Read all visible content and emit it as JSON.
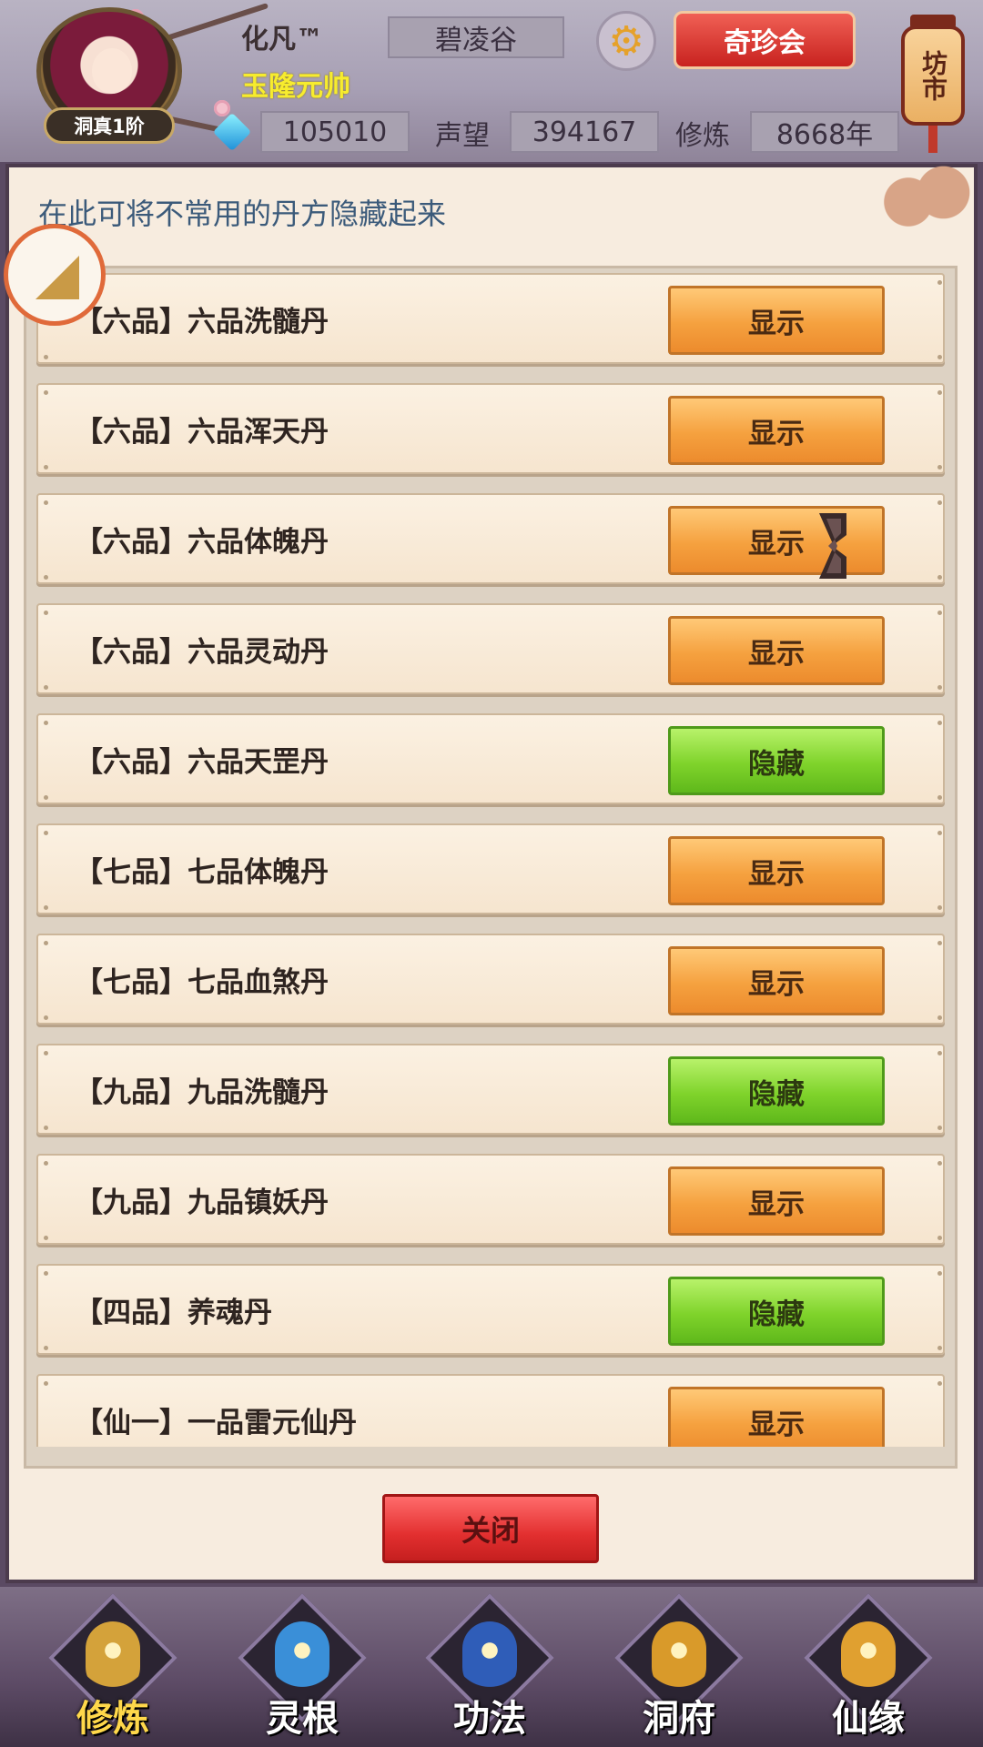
{
  "header": {
    "player_name": "化凡™",
    "player_title": "玉隆元帅",
    "rank_badge": "洞真1阶",
    "sect": "碧凌谷",
    "treasure_button": "奇珍会",
    "market_lantern": "坊市",
    "gems": "105010",
    "reputation_label": "声望",
    "reputation": "394167",
    "cultivation_label": "修炼",
    "cultivation": "8668年"
  },
  "panel": {
    "hint": "在此可将不常用的丹方隐藏起来",
    "close_label": "关闭",
    "rows": [
      {
        "text": "【六品】六品洗髓丹",
        "button": "显示",
        "state": "show"
      },
      {
        "text": "【六品】六品浑天丹",
        "button": "显示",
        "state": "show"
      },
      {
        "text": "【六品】六品体魄丹",
        "button": "显示",
        "state": "show"
      },
      {
        "text": "【六品】六品灵动丹",
        "button": "显示",
        "state": "show"
      },
      {
        "text": "【六品】六品天罡丹",
        "button": "隐藏",
        "state": "hide"
      },
      {
        "text": "【七品】七品体魄丹",
        "button": "显示",
        "state": "show"
      },
      {
        "text": "【七品】七品血煞丹",
        "button": "显示",
        "state": "show"
      },
      {
        "text": "【九品】九品洗髓丹",
        "button": "隐藏",
        "state": "hide"
      },
      {
        "text": "【九品】九品镇妖丹",
        "button": "显示",
        "state": "show"
      },
      {
        "text": "【四品】养魂丹",
        "button": "隐藏",
        "state": "hide"
      },
      {
        "text": "【仙一】一品雷元仙丹",
        "button": "显示",
        "state": "show"
      }
    ]
  },
  "nav": [
    {
      "label": "修炼",
      "icon": "monk-icon",
      "active": true,
      "color": "#d4a23a"
    },
    {
      "label": "灵根",
      "icon": "yinyang-sword-icon",
      "active": false,
      "color": "#3a8fd8"
    },
    {
      "label": "功法",
      "icon": "book-icon",
      "active": false,
      "color": "#2f5db8"
    },
    {
      "label": "洞府",
      "icon": "pagoda-icon",
      "active": false,
      "color": "#d99a2a"
    },
    {
      "label": "仙缘",
      "icon": "gourd-icon",
      "active": false,
      "color": "#e0a030"
    }
  ],
  "colors": {
    "show_button": "#f5a13f",
    "hide_button": "#7fd32b",
    "close_button": "#e22f2f"
  }
}
